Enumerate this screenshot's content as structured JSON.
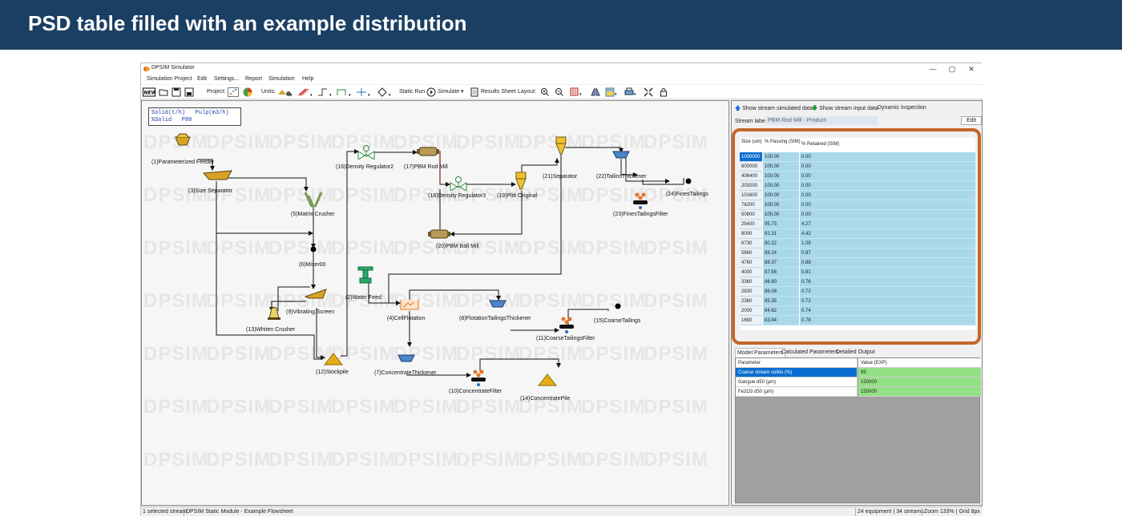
{
  "slide": {
    "title": "PSD table filled with an example distribution"
  },
  "app": {
    "title": "DPSIM Simulator",
    "controls": [
      "—",
      "▢",
      "✕"
    ]
  },
  "menu": [
    "Simulation Project",
    "Edit",
    "Settings...",
    "Report",
    "Simulation",
    "Help"
  ],
  "toolbar": {
    "project_label": "Project:",
    "units_label": "Units:",
    "static_run": "Static Run",
    "simulate": "Simulate",
    "results_sheet": "Results Sheet",
    "layout_label": "Layout:"
  },
  "legend": {
    "line1": "Solid(t/h)   Pulp(m3/h)",
    "line2": "%Solid   P80"
  },
  "watermark": "DPSIM",
  "units": {
    "u1": "(1)Parameterized Feeder",
    "u3": "(3)Size Separator",
    "u5": "(5)Matrix Crusher",
    "u6": "(6)Mixer00",
    "u9": "(9)Vibrating Screen",
    "u13": "(13)Whiten Crusher",
    "u12": "(12)Stockpile",
    "u16": "(16)Density Regulator2",
    "u17": "(17)PBM Rod Mill",
    "u18": "(18)Density Regulator3",
    "u19": "(19)Plitt Original",
    "u20": "(20)PBM Ball Mill",
    "u21": "(21)Separator",
    "u22": "(22)TailinsThickener",
    "u23": "(23)FinesTailingsFilter",
    "u24": "(24)FinesTailings",
    "u2": "(2)Water Feed",
    "u4": "(4)CellFlotation",
    "u8": "(8)FlotationTailingsThickener",
    "u11": "(11)CoarseTailingsFilter",
    "u15": "(15)CoarseTailings",
    "u7": "(7)ConcentrateThickener",
    "u10": "(10)ConcentrateFilter",
    "u14": "(14)ConcentratePile"
  },
  "right_panel": {
    "show_simulated": "Show stream simulated data",
    "show_input": "Show stream input data",
    "dynamic": "Dynamic inspection",
    "stream_label": "Stream label",
    "stream_name": "PBM Rod Mill - Product",
    "edit": "Edit",
    "psd_headers": [
      "Size\n(um)",
      "% Passing\n(SIM)",
      "% Retained (SIM)"
    ],
    "psd_rows": [
      [
        "1000000",
        "100.00",
        "0.00"
      ],
      [
        "600000",
        "100.00",
        "0.00"
      ],
      [
        "406400",
        "100.00",
        "0.00"
      ],
      [
        "203200",
        "100.00",
        "0.00"
      ],
      [
        "101600",
        "100.00",
        "0.00"
      ],
      [
        "76200",
        "100.00",
        "0.00"
      ],
      [
        "50800",
        "100.00",
        "0.00"
      ],
      [
        "25400",
        "95.73",
        "4.27"
      ],
      [
        "8000",
        "91.31",
        "4.42"
      ],
      [
        "6730",
        "90.22",
        "1.09"
      ],
      [
        "5660",
        "89.24",
        "0.97"
      ],
      [
        "4760",
        "88.37",
        "0.88"
      ],
      [
        "4000",
        "87.56",
        "0.81"
      ],
      [
        "3360",
        "86.80",
        "0.76"
      ],
      [
        "2830",
        "86.08",
        "0.72"
      ],
      [
        "2380",
        "85.35",
        "0.72"
      ],
      [
        "2000",
        "84.62",
        "0.74"
      ],
      [
        "1680",
        "83.84",
        "0.78"
      ]
    ],
    "tabs": [
      "Model Parameters",
      "Calculated Parameters",
      "Detailed Output"
    ],
    "param_headers": [
      "Parameter",
      "Value (EXP)"
    ],
    "params": [
      [
        "Coarse stream solids (%)",
        "85"
      ],
      [
        "Gangue d50 (µm)",
        "150000"
      ],
      [
        "Fe2O3 d50 (µm)",
        "150000"
      ]
    ]
  },
  "status": {
    "left1": "1 selected stream",
    "left2": "DPSIM Static Module - Example Flowsheet",
    "r1": "24 equipment | 34 streams",
    "r2": "Zoom 133% | Grid 8px"
  }
}
